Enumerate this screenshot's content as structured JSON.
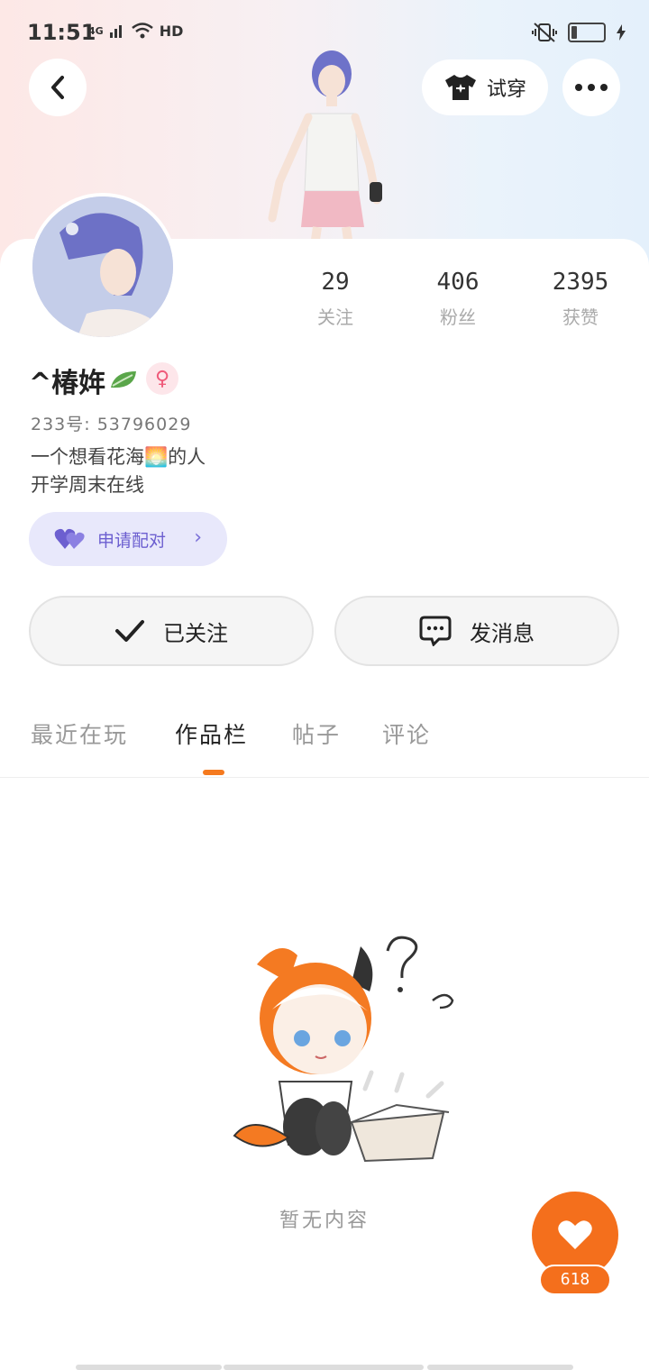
{
  "status_bar": {
    "time": "11:51",
    "network": "4G",
    "hd": "HD"
  },
  "header": {
    "try_on_label": "试穿"
  },
  "profile": {
    "stats": [
      {
        "value": "29",
        "label": "关注"
      },
      {
        "value": "406",
        "label": "粉丝"
      },
      {
        "value": "2395",
        "label": "获赞"
      }
    ],
    "name": "^椿姩",
    "gender_symbol": "♀",
    "uid": "233号: 53796029",
    "bio": [
      "一个想看花海🌅的人",
      "开学周末在线"
    ],
    "pair_button_label": "申请配对"
  },
  "actions": {
    "follow_label": "已关注",
    "message_label": "发消息"
  },
  "tabs": [
    {
      "label": "最近在玩",
      "active": false
    },
    {
      "label": "作品栏",
      "active": true
    },
    {
      "label": "帖子",
      "active": false
    },
    {
      "label": "评论",
      "active": false
    }
  ],
  "empty_state": {
    "text": "暂无内容"
  },
  "like": {
    "count": "618"
  },
  "colors": {
    "accent": "#f46f1c",
    "pair_purple": "#6c5fd0"
  }
}
